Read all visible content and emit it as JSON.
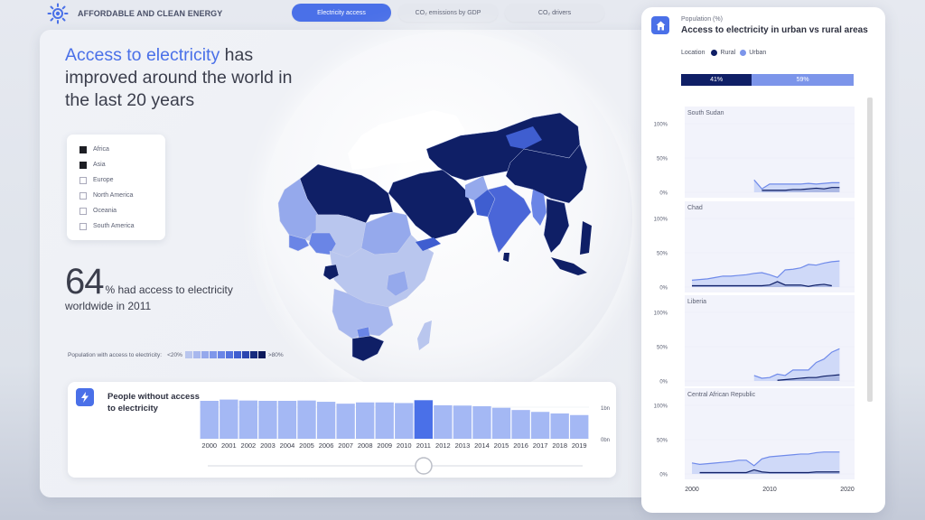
{
  "header": {
    "brand_icon": "sun-icon",
    "title": "AFFORDABLE AND CLEAN ENERGY",
    "tabs": [
      {
        "label": "Electricity access",
        "active": true
      },
      {
        "label": "CO₂ emissions by GDP",
        "active": false
      },
      {
        "label": "CO₂ drivers",
        "active": false
      }
    ]
  },
  "headline": {
    "accent": "Access to electricity",
    "rest": " has improved around the world in the last 20 years"
  },
  "region_filter": {
    "items": [
      {
        "label": "Africa",
        "checked": true
      },
      {
        "label": "Asia",
        "checked": true
      },
      {
        "label": "Europe",
        "checked": false
      },
      {
        "label": "North America",
        "checked": false
      },
      {
        "label": "Oceania",
        "checked": false
      },
      {
        "label": "South America",
        "checked": false
      }
    ]
  },
  "kpi": {
    "value": "64",
    "text": "% had access to electricity",
    "subtext": "worldwide in 2011"
  },
  "scale_legend": {
    "label": "Population with access to electricity:",
    "min_label": "<20%",
    "max_label": ">80%",
    "colors": [
      "#b9c6ee",
      "#a8b8ee",
      "#95a9ec",
      "#7f97ea",
      "#6a85e6",
      "#5472de",
      "#3f5ed0",
      "#2b45b0",
      "#152a7e",
      "#0d1a5c"
    ]
  },
  "map": {
    "colors": {
      "very_low": "#b9c6ee",
      "low": "#95a9ec",
      "mid": "#6a85e6",
      "high": "#3f5ed0",
      "very_high": "#0f1f66",
      "land_unselected": "#ffffff"
    }
  },
  "people_card": {
    "icon": "lightning-bolt-icon",
    "title": "People without access to electricity",
    "selected_year": "2011",
    "bar_color": "#a4b8f4",
    "highlight_color": "#4a70e8"
  },
  "right_panel": {
    "icon": "home-icon",
    "subtitle": "Population (%)",
    "title": "Access to electricity in urban vs rural areas",
    "legend_label": "Location",
    "legend": [
      {
        "label": "Rural",
        "color": "#0f1f66"
      },
      {
        "label": "Urban",
        "color": "#7c95ea"
      }
    ],
    "split": [
      {
        "label": "41%",
        "value": 41,
        "color": "#0f1f66"
      },
      {
        "label": "59%",
        "value": 59,
        "color": "#7c95ea"
      }
    ]
  },
  "chart_data": [
    {
      "type": "bar",
      "title": "People without access to electricity",
      "categories": [
        "2000",
        "2001",
        "2002",
        "2003",
        "2004",
        "2005",
        "2006",
        "2007",
        "2008",
        "2009",
        "2010",
        "2011",
        "2012",
        "2013",
        "2014",
        "2015",
        "2016",
        "2017",
        "2018",
        "2019"
      ],
      "values": [
        1.2,
        1.24,
        1.21,
        1.2,
        1.2,
        1.21,
        1.17,
        1.11,
        1.15,
        1.15,
        1.13,
        1.22,
        1.06,
        1.05,
        1.03,
        0.98,
        0.91,
        0.85,
        0.8,
        0.75
      ],
      "ylabel": "",
      "yticks": [
        "0bn",
        "1bn"
      ],
      "ylim": [
        0,
        1.4
      ],
      "highlight": "2011",
      "units": "billion people"
    },
    {
      "type": "area",
      "title": "South Sudan",
      "x": [
        2000,
        2020
      ],
      "xticks": [
        "2000",
        "2010",
        "2020"
      ],
      "yticks": [
        "0%",
        "50%",
        "100%"
      ],
      "ylim": [
        0,
        100
      ],
      "series": [
        {
          "name": "Urban",
          "x": [
            2008,
            2009,
            2010,
            2011,
            2012,
            2013,
            2014,
            2015,
            2016,
            2017,
            2018,
            2019
          ],
          "values": [
            18,
            5,
            12,
            12,
            12,
            12,
            12,
            13,
            12,
            13,
            14,
            14
          ]
        },
        {
          "name": "Rural",
          "x": [
            2009,
            2010,
            2011,
            2012,
            2013,
            2014,
            2015,
            2016,
            2017,
            2018,
            2019
          ],
          "values": [
            3,
            3,
            3,
            3,
            4,
            4,
            5,
            6,
            5,
            7,
            7
          ]
        }
      ]
    },
    {
      "type": "area",
      "title": "Chad",
      "xticks": [
        "2000",
        "2010",
        "2020"
      ],
      "yticks": [
        "0%",
        "50%",
        "100%"
      ],
      "ylim": [
        0,
        100
      ],
      "series": [
        {
          "name": "Urban",
          "x": [
            2000,
            2001,
            2002,
            2003,
            2004,
            2005,
            2006,
            2007,
            2008,
            2009,
            2010,
            2011,
            2012,
            2013,
            2014,
            2015,
            2016,
            2017,
            2018,
            2019
          ],
          "values": [
            10,
            11,
            12,
            14,
            16,
            16,
            17,
            18,
            20,
            21,
            18,
            14,
            25,
            26,
            28,
            33,
            32,
            35,
            37,
            38
          ]
        },
        {
          "name": "Rural",
          "x": [
            2000,
            2001,
            2002,
            2003,
            2004,
            2005,
            2006,
            2007,
            2008,
            2009,
            2010,
            2011,
            2012,
            2013,
            2014,
            2015,
            2016,
            2017,
            2018
          ],
          "values": [
            2,
            2,
            2,
            2,
            2,
            2,
            2,
            2,
            2,
            2,
            3,
            8,
            3,
            3,
            3,
            1,
            3,
            4,
            2
          ]
        }
      ]
    },
    {
      "type": "area",
      "title": "Liberia",
      "xticks": [
        "2000",
        "2010",
        "2020"
      ],
      "yticks": [
        "0%",
        "50%",
        "100%"
      ],
      "ylim": [
        0,
        100
      ],
      "series": [
        {
          "name": "Urban",
          "x": [
            2008,
            2009,
            2010,
            2011,
            2012,
            2013,
            2014,
            2015,
            2016,
            2017,
            2018,
            2019
          ],
          "values": [
            8,
            4,
            5,
            10,
            8,
            16,
            16,
            16,
            27,
            32,
            42,
            47
          ]
        },
        {
          "name": "Rural",
          "x": [
            2011,
            2012,
            2013,
            2014,
            2015,
            2016,
            2017,
            2018,
            2019
          ],
          "values": [
            1,
            2,
            3,
            4,
            5,
            5,
            7,
            8,
            9
          ]
        }
      ]
    },
    {
      "type": "area",
      "title": "Central African Republic",
      "xticks": [
        "2000",
        "2010",
        "2020"
      ],
      "yticks": [
        "0%",
        "50%",
        "100%"
      ],
      "ylim": [
        0,
        100
      ],
      "series": [
        {
          "name": "Urban",
          "x": [
            2000,
            2001,
            2002,
            2003,
            2004,
            2005,
            2006,
            2007,
            2008,
            2009,
            2010,
            2011,
            2012,
            2013,
            2014,
            2015,
            2016,
            2017,
            2018,
            2019
          ],
          "values": [
            16,
            14,
            15,
            16,
            17,
            18,
            20,
            20,
            12,
            22,
            25,
            26,
            27,
            28,
            29,
            29,
            31,
            32,
            32,
            32
          ]
        },
        {
          "name": "Rural",
          "x": [
            2001,
            2002,
            2003,
            2004,
            2005,
            2006,
            2007,
            2008,
            2009,
            2010,
            2011,
            2012,
            2013,
            2014,
            2015,
            2016,
            2017,
            2018,
            2019
          ],
          "values": [
            2,
            2,
            2,
            2,
            2,
            2,
            2,
            6,
            3,
            2,
            2,
            2,
            2,
            2,
            2,
            3,
            3,
            3,
            3
          ]
        }
      ]
    }
  ]
}
